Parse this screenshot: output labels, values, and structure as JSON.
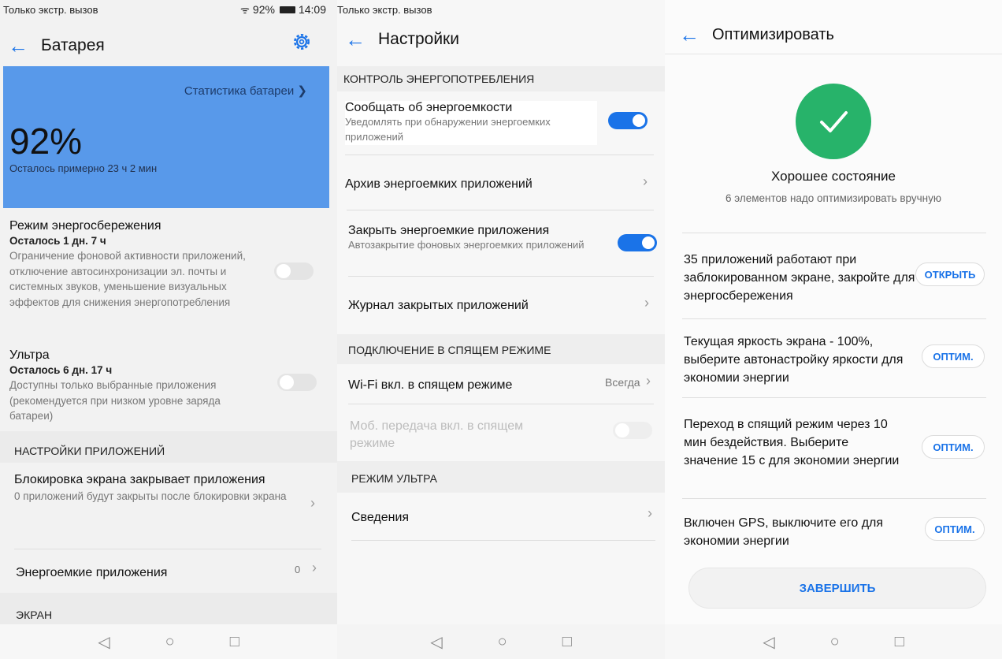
{
  "status": {
    "carrier": "Только экстр. вызов",
    "battery_pct": "92%",
    "time1": "14:09"
  },
  "battery": {
    "title": "Батарея",
    "stats_link": "Статистика батареи",
    "percent": "92%",
    "remaining": "Осталось примерно 23 ч 2 мин",
    "power_save": {
      "title": "Режим энергосбережения",
      "remain": "Осталось 1 дн. 7 ч",
      "desc": "Ограничение фоновой активности приложений, отключение автосинхронизации эл. почты и системных звуков, уменьшение визуальных эффектов для снижения энергопотребления",
      "enabled": false
    },
    "ultra": {
      "title": "Ультра",
      "remain": "Осталось 6 дн. 17 ч",
      "desc": "Доступны только выбранные приложения (рекомендуется при низком уровне заряда батареи)",
      "enabled": false
    },
    "section_apps": "НАСТРОЙКИ ПРИЛОЖЕНИЙ",
    "lock_close": {
      "title": "Блокировка экрана закрывает приложения",
      "desc": "0 приложений будут закрыты после блокировки экрана"
    },
    "power_apps": {
      "title": "Энергоемкие приложения",
      "value": "0"
    },
    "section_screen": "ЭКРАН"
  },
  "settings": {
    "title": "Настройки",
    "section_control": "КОНТРОЛЬ ЭНЕРГОПОТРЕБЛЕНИЯ",
    "notify": {
      "title": "Сообщать об энергоемкости",
      "desc": "Уведомлять при обнаружении энергоемких приложений",
      "enabled": true
    },
    "archive": "Архив энергоемких приложений",
    "close_apps": {
      "title": "Закрыть энергоемкие приложения",
      "desc": "Автозакрытие фоновых энергоемких приложений",
      "enabled": true
    },
    "closed_log": "Журнал закрытых приложений",
    "section_sleep": "ПОДКЛЮЧЕНИЕ В СПЯЩЕМ РЕЖИМЕ",
    "wifi_sleep": {
      "title": "Wi-Fi вкл. в спящем режиме",
      "value": "Всегда"
    },
    "mobile_sleep": {
      "title": "Моб. передача вкл. в спящем режиме",
      "enabled": false
    },
    "section_ultra": "РЕЖИМ УЛЬТРА",
    "info": "Сведения"
  },
  "optimize": {
    "title": "Оптимизировать",
    "state": "Хорошее состояние",
    "subtitle": "6 элементов надо оптимизировать вручную",
    "items": [
      {
        "text": "35 приложений работают при заблокированном экране, закройте для энергосбережения",
        "action": "ОТКРЫТЬ"
      },
      {
        "text": "Текущая яркость экрана - 100%, выберите автонастройку яркости для экономии энергии",
        "action": "ОПТИМ."
      },
      {
        "text": "Переход в спящий режим через 10 мин бездействия. Выберите значение 15 с для экономии энергии",
        "action": "ОПТИМ."
      },
      {
        "text": "Включен GPS, выключите его для экономии энергии",
        "action": "ОПТИМ."
      }
    ],
    "finish": "ЗАВЕРШИТЬ"
  },
  "nav": {
    "back": "◁",
    "home": "○",
    "recent": "□"
  },
  "colors": {
    "accent": "#1a73e8",
    "hero": "#5899ea",
    "success": "#27b36a"
  }
}
